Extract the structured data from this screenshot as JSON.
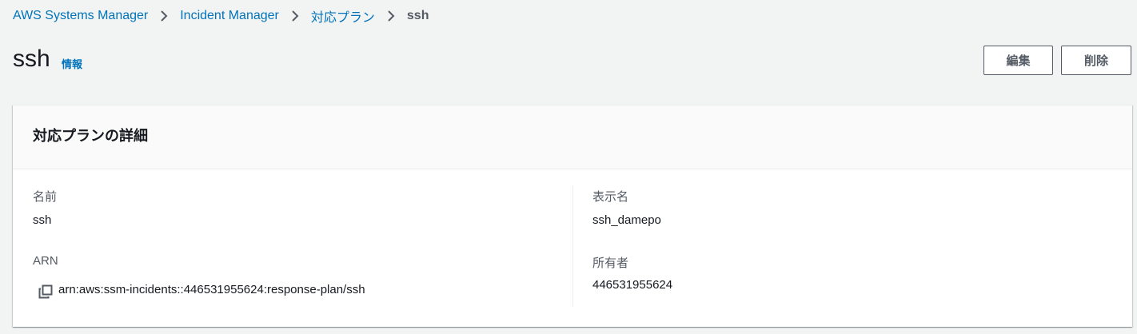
{
  "breadcrumb": {
    "items": [
      "AWS Systems Manager",
      "Incident Manager",
      "対応プラン"
    ],
    "current": "ssh"
  },
  "header": {
    "title": "ssh",
    "info_link": "情報",
    "edit_label": "編集",
    "delete_label": "削除"
  },
  "details": {
    "title": "対応プランの詳細",
    "name_label": "名前",
    "name_value": "ssh",
    "arn_label": "ARN",
    "arn_value": "arn:aws:ssm-incidents::446531955624:response-plan/ssh",
    "display_name_label": "表示名",
    "display_name_value": "ssh_damepo",
    "owner_label": "所有者",
    "owner_value": "446531955624"
  },
  "icons": {
    "breadcrumb_separator": "chevron-right-icon",
    "copy": "copy-icon"
  },
  "colors": {
    "link": "#0073bb",
    "text": "#16191f",
    "secondary_text": "#545b64",
    "background": "#f2f3f3"
  }
}
